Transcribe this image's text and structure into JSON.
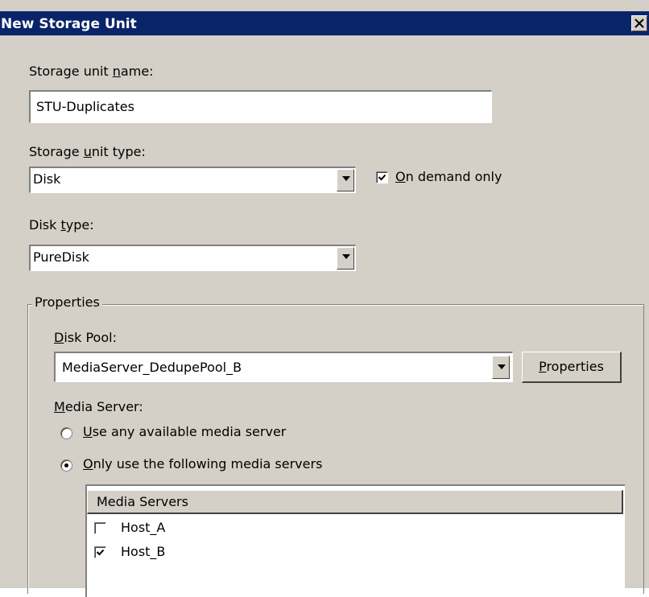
{
  "window": {
    "title": "New Storage Unit",
    "close_glyph": "×"
  },
  "storage_unit_name": {
    "label_pre": "Storage unit ",
    "label_key": "n",
    "label_post": "ame:",
    "value": "STU-Duplicates"
  },
  "storage_unit_type": {
    "label_pre": "Storage ",
    "label_key": "u",
    "label_post": "nit type:",
    "value": "Disk"
  },
  "on_demand": {
    "label_key": "O",
    "label_post": "n demand only",
    "checked": true
  },
  "disk_type": {
    "label_pre": "Disk ",
    "label_key": "t",
    "label_post": "ype:",
    "value": "PureDisk"
  },
  "properties_group": {
    "legend": "Properties"
  },
  "disk_pool": {
    "label_key": "D",
    "label_post": "isk Pool:",
    "value": "MediaServer_DedupePool_B"
  },
  "properties_button": {
    "label_key": "P",
    "label_post": "roperties"
  },
  "media_server": {
    "label_key": "M",
    "label_post": "edia Server:",
    "option_any": {
      "label_key": "U",
      "label_post": "se any available media server",
      "selected": false
    },
    "option_only": {
      "label_key": "O",
      "label_post": "nly use the following media servers",
      "selected": true
    }
  },
  "media_servers_list": {
    "header": "Media Servers",
    "items": [
      {
        "name": "Host_A",
        "checked": false
      },
      {
        "name": "Host_B",
        "checked": true
      }
    ]
  }
}
